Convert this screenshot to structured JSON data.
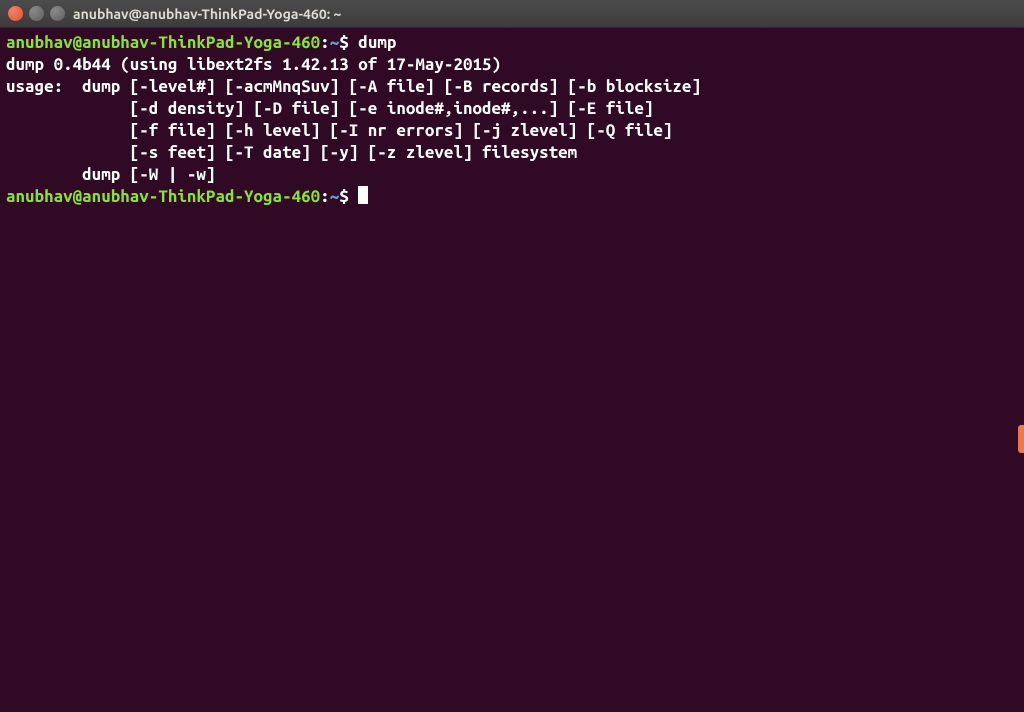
{
  "window": {
    "title": "anubhav@anubhav-ThinkPad-Yoga-460: ~"
  },
  "prompt": {
    "userhost": "anubhav@anubhav-ThinkPad-Yoga-460",
    "sep": ":",
    "path": "~",
    "sigil": "$"
  },
  "commands": {
    "first": "dump"
  },
  "output": {
    "l1": "dump 0.4b44 (using libext2fs 1.42.13 of 17-May-2015)",
    "l2": "usage:  dump [-level#] [-acmMnqSuv] [-A file] [-B records] [-b blocksize]",
    "l3": "             [-d density] [-D file] [-e inode#,inode#,...] [-E file]",
    "l4": "             [-f file] [-h level] [-I nr errors] [-j zlevel] [-Q file]",
    "l5": "             [-s feet] [-T date] [-y] [-z zlevel] filesystem",
    "l6": "        dump [-W | -w]"
  }
}
